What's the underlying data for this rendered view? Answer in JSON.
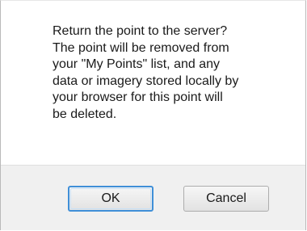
{
  "dialog": {
    "message": "Return the point to the server?\nThe point will be removed from\nyour \"My Points\" list, and any\ndata or imagery stored locally by\nyour browser for this point will\nbe deleted.",
    "ok_label": "OK",
    "cancel_label": "Cancel"
  },
  "colors": {
    "button_area_background": "#f0f0f0",
    "default_button_border": "#3f8fd8"
  }
}
